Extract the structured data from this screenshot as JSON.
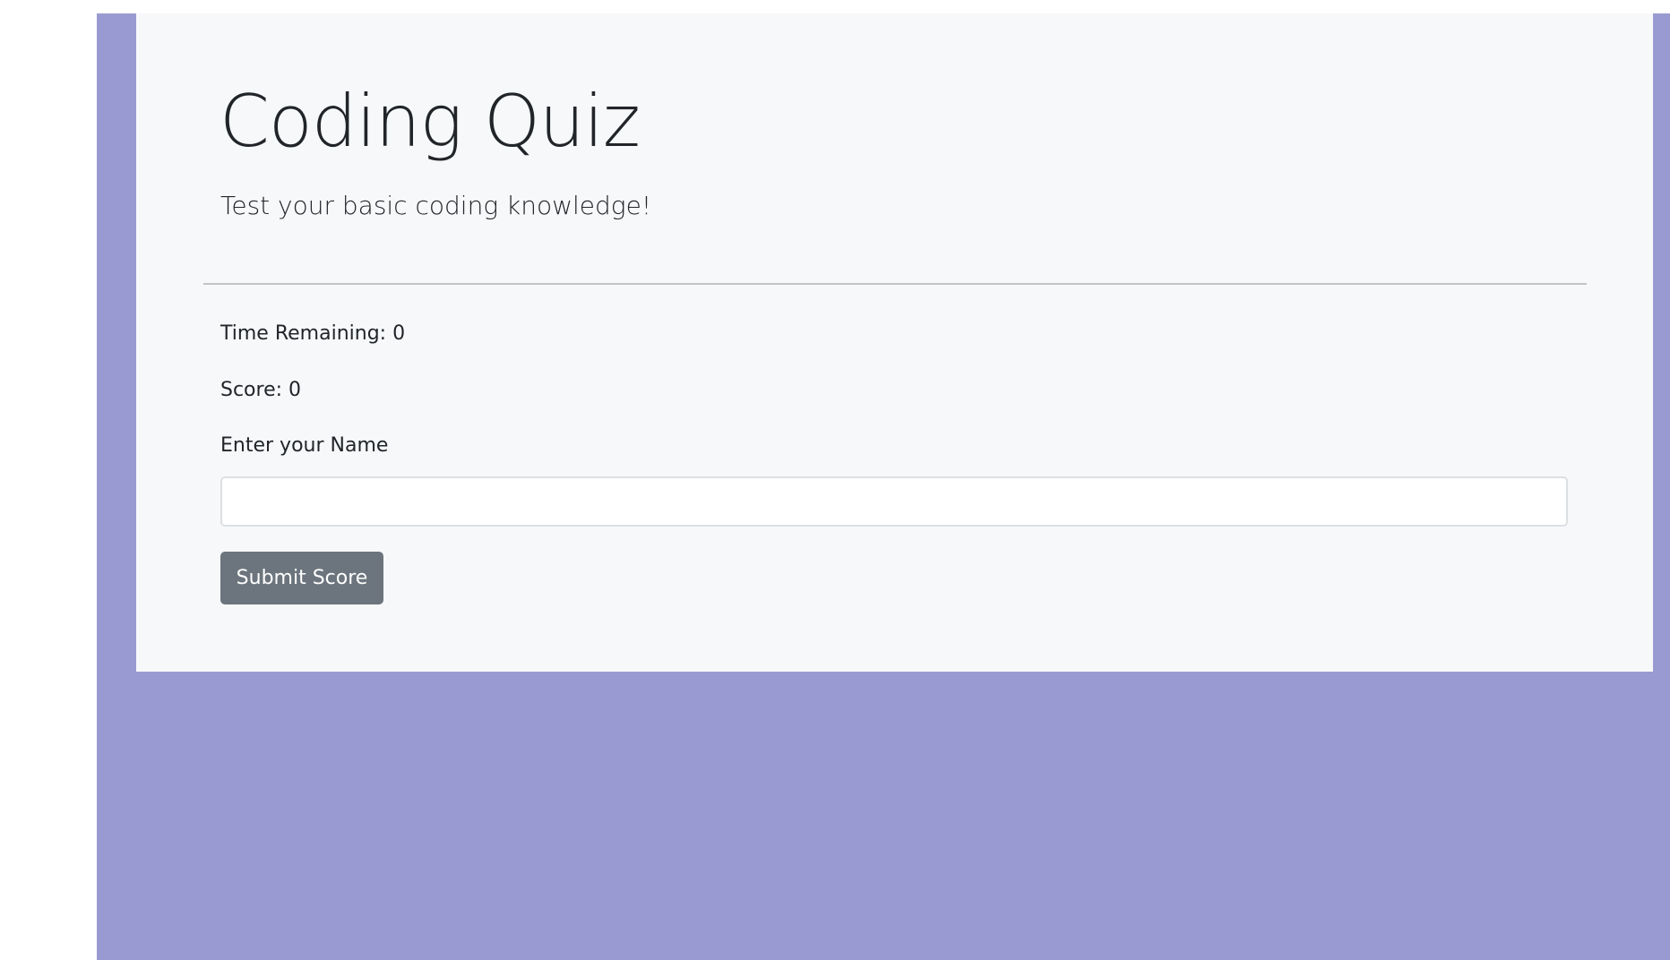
{
  "header": {
    "title": "Coding Quiz",
    "subtitle": "Test your basic coding knowledge!"
  },
  "stats": {
    "time_label": "Time Remaining:",
    "time_value": "0",
    "score_label": "Score:",
    "score_value": "0"
  },
  "form": {
    "name_label": "Enter your Name",
    "name_value": "",
    "name_placeholder": "",
    "submit_label": "Submit Score"
  },
  "colors": {
    "page_background": "#9a9ad2",
    "panel_background": "#f7f8fa",
    "button_background": "#6c757d",
    "text": "#212529"
  }
}
